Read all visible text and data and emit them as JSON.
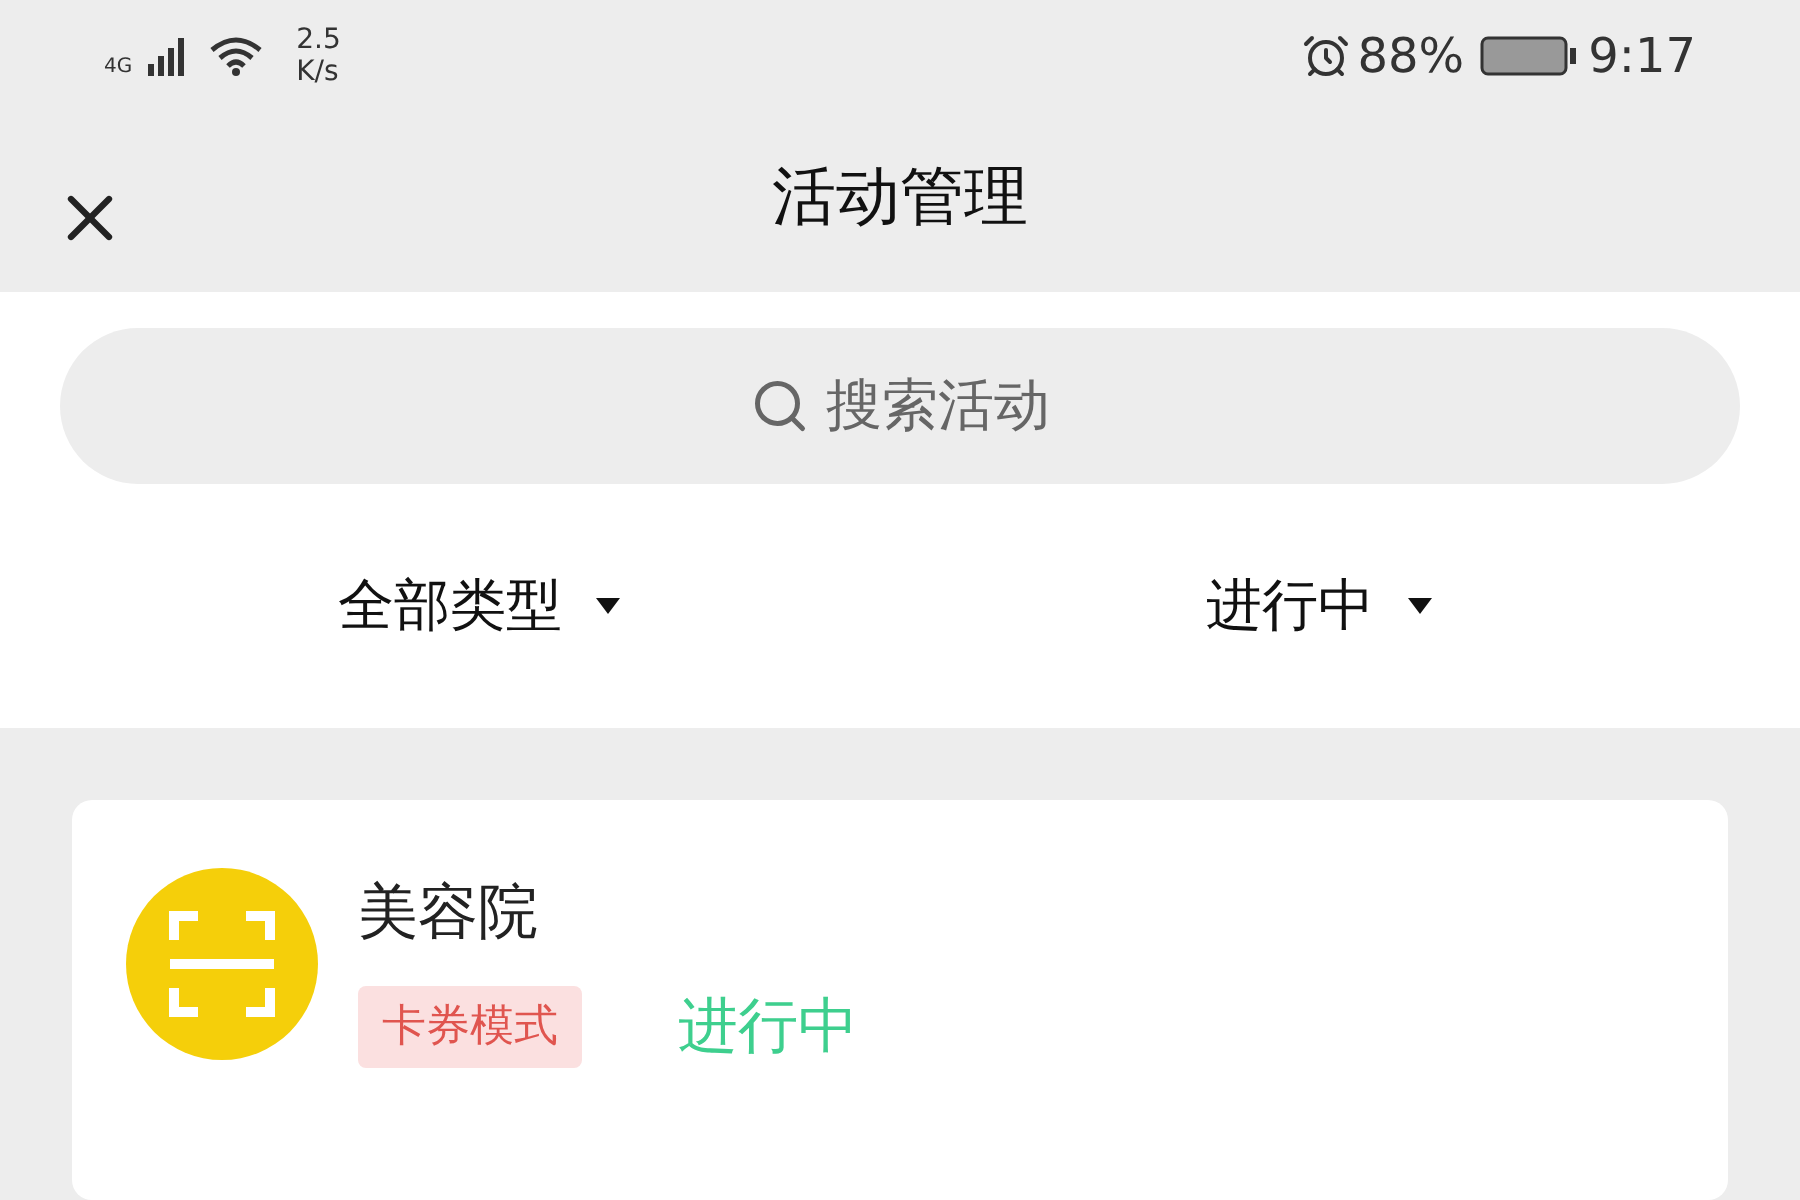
{
  "status_bar": {
    "network": "4G",
    "speed_value": "2.5",
    "speed_unit": "K/s",
    "battery": "88%",
    "time": "9:17"
  },
  "header": {
    "title": "活动管理"
  },
  "search": {
    "placeholder": "搜索活动"
  },
  "filters": [
    {
      "label": "全部类型"
    },
    {
      "label": "进行中"
    }
  ],
  "activities": [
    {
      "name": "美容院",
      "tag": "卡券模式",
      "status": "进行中",
      "color": "#3ecf8e"
    }
  ]
}
